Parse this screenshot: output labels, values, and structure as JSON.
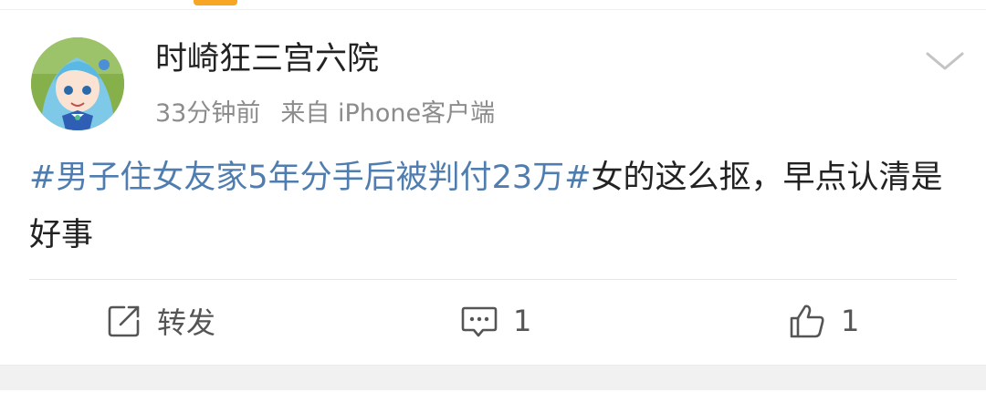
{
  "post": {
    "username": "时崎狂三宫六院",
    "time": "33分钟前",
    "source": "来自 iPhone客户端",
    "hashtag": "#男子住女友家5年分手后被判付23万#",
    "text": "女的这么抠，早点认清是好事"
  },
  "actions": {
    "repost_label": "转发",
    "comment_count": "1",
    "like_count": "1"
  },
  "icons": {
    "more": "chevron-down-icon",
    "repost": "share-icon",
    "comment": "comment-icon",
    "like": "thumbs-up-icon"
  },
  "colors": {
    "hashtag": "#507daf",
    "text": "#222222",
    "meta": "#8c8c8c",
    "accent": "#f6a623"
  }
}
